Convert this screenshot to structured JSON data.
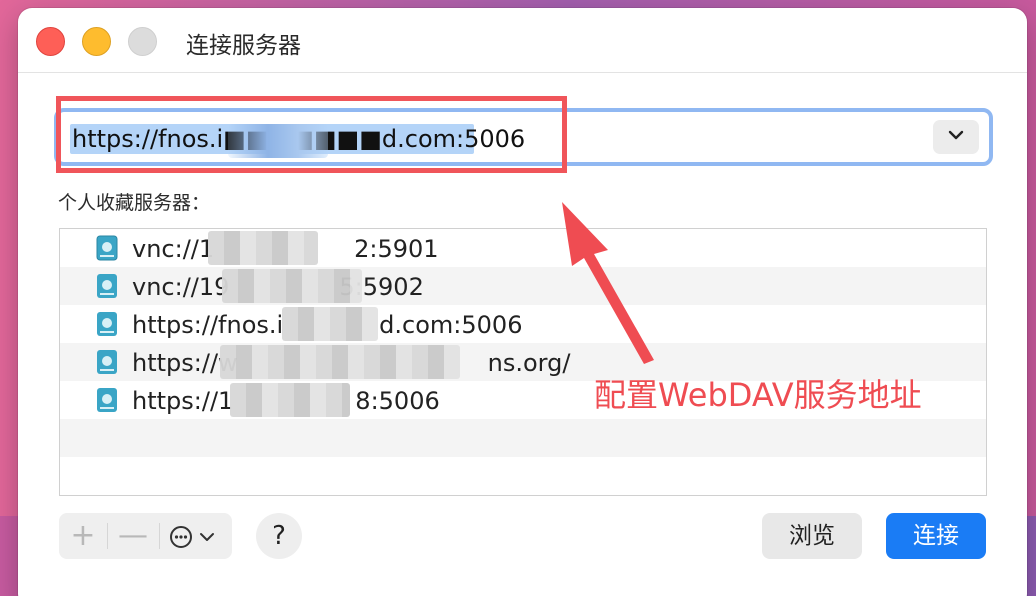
{
  "window": {
    "title": "连接服务器"
  },
  "address": {
    "value": "https://fnos.i■■■■■■■d.com:5006"
  },
  "favorites": {
    "label": "个人收藏服务器：",
    "items": [
      {
        "prefix": "vnc://1",
        "suffix": "2:5901"
      },
      {
        "prefix": "vnc://19",
        "suffix": "5:5902"
      },
      {
        "prefix": "https://fnos.i",
        "suffix": "d.com:5006"
      },
      {
        "prefix": "https://w",
        "suffix": "ns.org/"
      },
      {
        "prefix": "https://1",
        "suffix": "8:5006"
      }
    ]
  },
  "annotation": {
    "text": "配置WebDAV服务地址",
    "color": "#ef4c52"
  },
  "toolbar": {
    "add_label": "+",
    "remove_label": "—",
    "help_label": "?"
  },
  "buttons": {
    "browse_label": "浏览",
    "connect_label": "连接"
  },
  "colors": {
    "accent": "#1a7cf5",
    "highlight_box": "#f0555a",
    "focus_ring": "#90b8f2"
  }
}
